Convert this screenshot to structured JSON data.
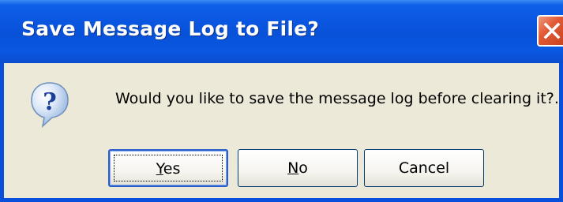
{
  "window": {
    "title": "Save Message Log to File?"
  },
  "icons": {
    "message_icon": "question-icon",
    "close_icon": "close-icon"
  },
  "colors": {
    "titlebar": "#0a56e0",
    "dialog_bg": "#ece9d8",
    "close_button": "#e25a35"
  },
  "message": "Would you like to save the message log before clearing it?.",
  "buttons": {
    "yes": {
      "mnemonic": "Y",
      "rest": "es"
    },
    "no": {
      "mnemonic": "N",
      "rest": "o"
    },
    "cancel": {
      "label": "Cancel"
    }
  }
}
